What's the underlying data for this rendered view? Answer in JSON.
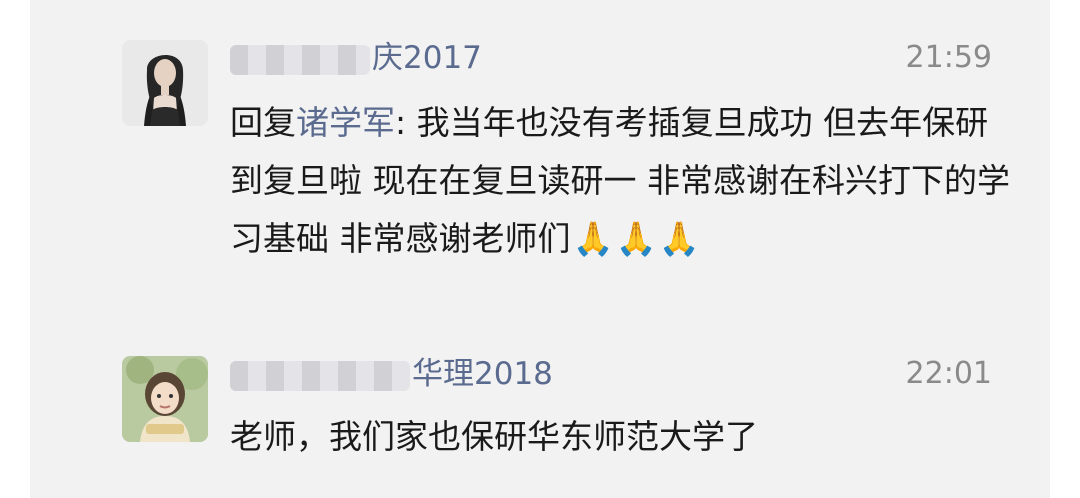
{
  "comments": [
    {
      "author_visible": "庆2017",
      "time": "21:59",
      "reply_prefix": "回复",
      "reply_to": "诸学军",
      "reply_colon": ": ",
      "text": "我当年也没有考插复旦成功 但去年保研到复旦啦 现在在复旦读研一 非常感谢在科兴打下的学习基础 非常感谢老师们",
      "emoji_1": "🙏",
      "emoji_2": "🙏",
      "emoji_3": "🙏"
    },
    {
      "author_visible": "华理2018",
      "time": "22:01",
      "text": "老师，我们家也保研华东师范大学了"
    }
  ],
  "colors": {
    "panel_bg": "#f2f2f2",
    "name_link": "#5b6b8f",
    "body_text": "#1a1a1a",
    "time_text": "#8a8a8a"
  }
}
